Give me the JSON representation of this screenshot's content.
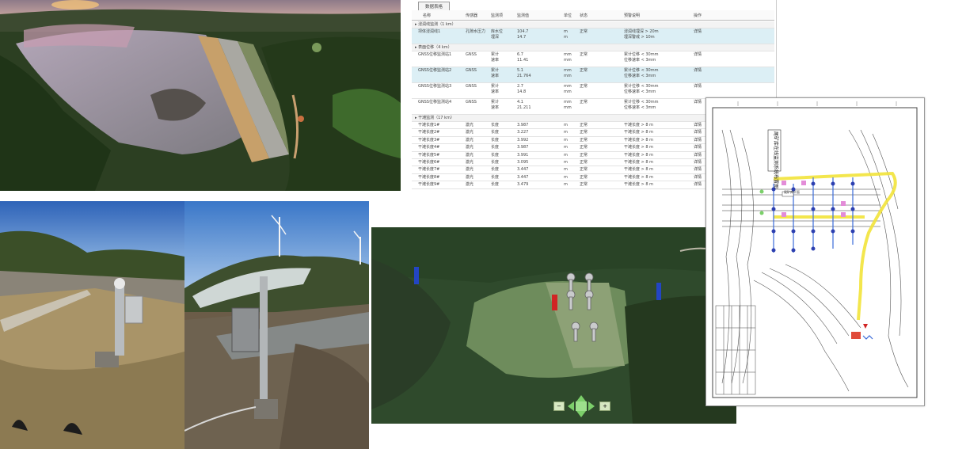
{
  "table": {
    "tab_label": "数据表格",
    "columns": [
      "名称",
      "传感器",
      "监测项",
      "监测值",
      "单位",
      "状态",
      "预警说明",
      "操作"
    ],
    "rows": [
      {
        "kind": "group",
        "c0": "▸ 浸润线监测（1 km）"
      },
      {
        "kind": "data",
        "hl": true,
        "c0": "坝体浸润线1",
        "c1": "孔隙水压力",
        "c2": "库水位\n埋深",
        "c3": "104.7\n14.7",
        "c4": "m\nm",
        "c5": "正常",
        "c6": "浸润线埋深 > 20m\n埋深警戒 > 10m",
        "c7": "详情"
      },
      {
        "kind": "group",
        "c0": "▸ 表面位移（4 km）"
      },
      {
        "kind": "data",
        "hl": false,
        "c0": "GNSS位移监测站1",
        "c1": "GNSS",
        "c2": "累计\n速率",
        "c3": "6.7\n11.41",
        "c4": "mm\nmm",
        "c5": "正常",
        "c6": "累计位移 < 30mm\n位移速率 < 3mm",
        "c7": "详情"
      },
      {
        "kind": "data",
        "hl": true,
        "c0": "GNSS位移监测站2",
        "c1": "GNSS",
        "c2": "累计\n速率",
        "c3": "5.1\n21.764",
        "c4": "mm\nmm",
        "c5": "正常",
        "c6": "累计位移 < 30mm\n位移速率 < 3mm",
        "c7": "详情"
      },
      {
        "kind": "data",
        "hl": false,
        "c0": "GNSS位移监测站3",
        "c1": "GNSS",
        "c2": "累计\n速率",
        "c3": "2.7\n14.8",
        "c4": "mm\nmm",
        "c5": "正常",
        "c6": "累计位移 < 30mm\n位移速率 < 3mm",
        "c7": "详情"
      },
      {
        "kind": "data",
        "hl": false,
        "c0": "GNSS位移监测站4",
        "c1": "GNSS",
        "c2": "累计\n速率",
        "c3": "4.1\n21.211",
        "c4": "mm\nmm",
        "c5": "正常",
        "c6": "累计位移 < 30mm\n位移速率 < 3mm",
        "c7": "详情"
      },
      {
        "kind": "group",
        "c0": "▸ 干滩监测（17 km）"
      },
      {
        "kind": "mini",
        "c0": "干滩长度1#",
        "c1": "激光",
        "c2": "长度",
        "c3": "3.987",
        "c4": "m",
        "c5": "正常",
        "c6": "干滩长度 > 8 m",
        "c7": "详情"
      },
      {
        "kind": "mini",
        "c0": "干滩长度2#",
        "c1": "激光",
        "c2": "长度",
        "c3": "3.227",
        "c4": "m",
        "c5": "正常",
        "c6": "干滩长度 > 8 m",
        "c7": "详情"
      },
      {
        "kind": "mini",
        "c0": "干滩长度3#",
        "c1": "激光",
        "c2": "长度",
        "c3": "3.992",
        "c4": "m",
        "c5": "正常",
        "c6": "干滩长度 > 8 m",
        "c7": "详情"
      },
      {
        "kind": "mini",
        "c0": "干滩长度4#",
        "c1": "激光",
        "c2": "长度",
        "c3": "3.987",
        "c4": "m",
        "c5": "正常",
        "c6": "干滩长度 > 8 m",
        "c7": "详情"
      },
      {
        "kind": "mini",
        "c0": "干滩长度5#",
        "c1": "激光",
        "c2": "长度",
        "c3": "3.991",
        "c4": "m",
        "c5": "正常",
        "c6": "干滩长度 > 8 m",
        "c7": "详情"
      },
      {
        "kind": "mini",
        "c0": "干滩长度6#",
        "c1": "激光",
        "c2": "长度",
        "c3": "3.095",
        "c4": "m",
        "c5": "正常",
        "c6": "干滩长度 > 8 m",
        "c7": "详情"
      },
      {
        "kind": "mini",
        "c0": "干滩长度7#",
        "c1": "激光",
        "c2": "长度",
        "c3": "3.447",
        "c4": "m",
        "c5": "正常",
        "c6": "干滩长度 > 8 m",
        "c7": "详情"
      },
      {
        "kind": "mini",
        "c0": "干滩长度8#",
        "c1": "激光",
        "c2": "长度",
        "c3": "3.447",
        "c4": "m",
        "c5": "正常",
        "c6": "干滩长度 > 8 m",
        "c7": "详情"
      },
      {
        "kind": "mini",
        "c0": "干滩长度9#",
        "c1": "激光",
        "c2": "长度",
        "c3": "3.479",
        "c4": "m",
        "c5": "正常",
        "c6": "干滩长度 > 8 m",
        "c7": "详情"
      }
    ]
  },
  "drawing": {
    "title": "尾矿库在线监测系统布置图",
    "plan_label": "尾矿库平面"
  },
  "map": {
    "markers_gray": 6,
    "nav_labels": [
      "缩小",
      "放大"
    ]
  },
  "colors": {
    "forest": "#2f4a24",
    "tailings": "#9a98a0",
    "sky": "#3f78c8",
    "table_highlight": "#dceff5",
    "route_yellow": "#f2e33a"
  }
}
